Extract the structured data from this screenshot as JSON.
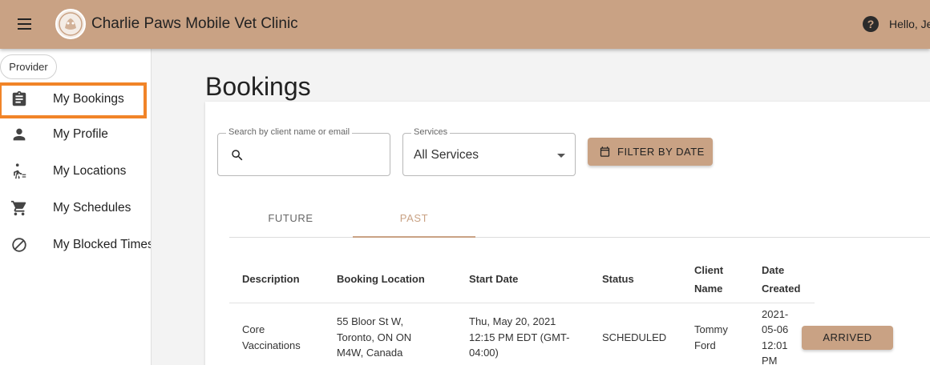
{
  "app": {
    "title": "Charlie Paws Mobile Vet Clinic",
    "greeting": "Hello, Je",
    "brand_color": "#c9a284",
    "highlight_color": "#f18428"
  },
  "sidebar": {
    "role_chip": "Provider",
    "items": [
      {
        "label": "My Bookings",
        "icon": "clipboard-icon",
        "active": true
      },
      {
        "label": "My Profile",
        "icon": "person-icon",
        "active": false
      },
      {
        "label": "My Locations",
        "icon": "walking-person-icon",
        "active": false
      },
      {
        "label": "My Schedules",
        "icon": "cart-icon",
        "active": false
      },
      {
        "label": "My Blocked Times",
        "icon": "blocked-icon",
        "active": false
      }
    ]
  },
  "page": {
    "title": "Bookings"
  },
  "filters": {
    "search_label": "Search by client name or email",
    "search_value": "",
    "services_label": "Services",
    "services_value": "All Services",
    "filter_button": "FILTER BY DATE"
  },
  "tabs": [
    {
      "label": "FUTURE",
      "active": false
    },
    {
      "label": "PAST",
      "active": true
    }
  ],
  "table": {
    "headers": {
      "description": "Description",
      "location": "Booking Location",
      "start": "Start Date",
      "status": "Status",
      "client_1": "Client",
      "client_2": "Name",
      "created_1": "Date",
      "created_2": "Created"
    },
    "rows": [
      {
        "description_1": "Core",
        "description_2": "Vaccinations",
        "location_1": "55 Bloor St W,",
        "location_2": "Toronto, ON ON",
        "location_3": "M4W, Canada",
        "start_1": "Thu, May 20, 2021",
        "start_2": "12:15 PM EDT (GMT-",
        "start_3": "04:00)",
        "status": "SCHEDULED",
        "client_1": "Tommy",
        "client_2": "Ford",
        "created_1": "2021-",
        "created_2": "05-06",
        "created_3": "12:01",
        "created_4": "PM",
        "action": "ARRIVED"
      }
    ]
  }
}
